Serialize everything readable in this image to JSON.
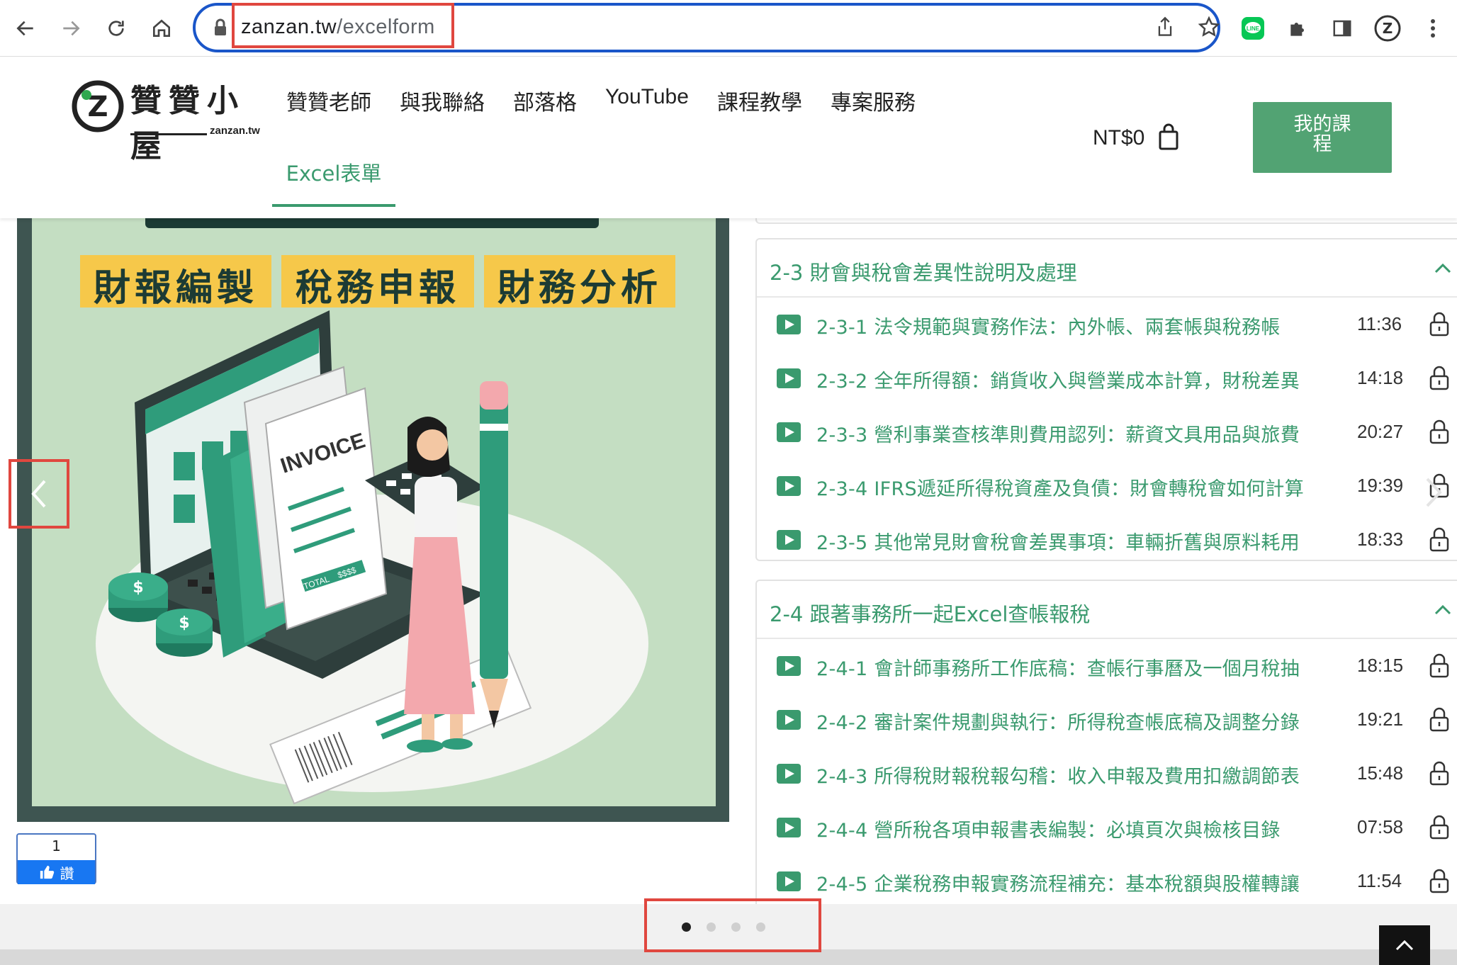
{
  "browser": {
    "url_host": "zanzan.tw",
    "url_path": "/excelform"
  },
  "header": {
    "logo_text": "贊贊小屋",
    "logo_sub": "zanzan.tw",
    "menu": [
      "贊贊老師",
      "與我聯絡",
      "部落格",
      "YouTube",
      "課程教學",
      "專案服務"
    ],
    "active_tab": "Excel表單",
    "cart": "NT$0",
    "my_course_line1": "我的課",
    "my_course_line2": "程"
  },
  "hero": {
    "tags": [
      "財報編製",
      "稅務申報",
      "財務分析"
    ],
    "invoice_label": "INVOICE",
    "total_label": "TOTAL",
    "amount_label": "$$$$"
  },
  "like": {
    "count": "1",
    "label": "讚"
  },
  "sections": [
    {
      "title": "2-3 財會與稅會差異性說明及處理",
      "lessons": [
        {
          "title": "2-3-1 法令規範與實務作法：內外帳、兩套帳與稅務帳",
          "time": "11:36"
        },
        {
          "title": "2-3-2 全年所得額：銷貨收入與營業成本計算，財稅差異",
          "time": "14:18"
        },
        {
          "title": "2-3-3 營利事業查核準則費用認列：薪資文具用品與旅費",
          "time": "20:27"
        },
        {
          "title": "2-3-4 IFRS遞延所得稅資產及負債：財會轉稅會如何計算",
          "time": "19:39"
        },
        {
          "title": "2-3-5 其他常見財會稅會差異事項：車輛折舊與原料耗用",
          "time": "18:33"
        }
      ]
    },
    {
      "title": "2-4 跟著事務所一起Excel查帳報稅",
      "lessons": [
        {
          "title": "2-4-1 會計師事務所工作底稿：查帳行事曆及一個月稅抽",
          "time": "18:15"
        },
        {
          "title": "2-4-2 審計案件規劃與執行：所得稅查帳底稿及調整分錄",
          "time": "19:21"
        },
        {
          "title": "2-4-3 所得稅財報稅報勾稽：收入申報及費用扣繳調節表",
          "time": "15:48"
        },
        {
          "title": "2-4-4 營所稅各項申報書表編製：必填頁次與檢核目錄",
          "time": "07:58"
        },
        {
          "title": "2-4-5 企業稅務申報實務流程補充：基本稅額與股權轉讓",
          "time": "11:54"
        }
      ]
    }
  ],
  "carousel": {
    "active_dot": 0,
    "dot_count": 4
  },
  "colors": {
    "brand_green": "#3a9a6e",
    "button_green": "#52a373",
    "tag_yellow": "#f6c84a",
    "highlight_red": "#e0473f",
    "omnibox_blue": "#1a56c9"
  }
}
